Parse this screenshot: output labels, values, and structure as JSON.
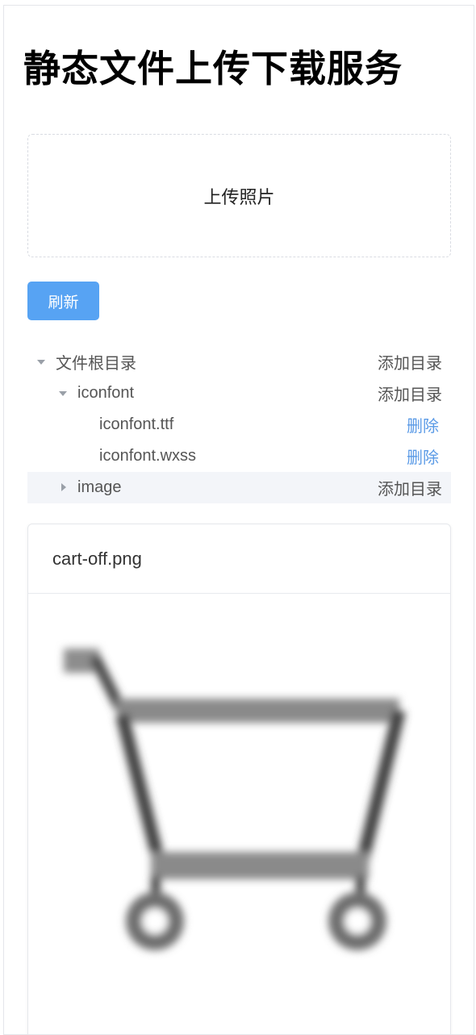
{
  "page": {
    "title": "静态文件上传下载服务"
  },
  "upload": {
    "label": "上传照片"
  },
  "toolbar": {
    "refresh_label": "刷新"
  },
  "tree": {
    "root": {
      "label": "文件根目录",
      "action": "添加目录",
      "expanded": true
    },
    "folders": [
      {
        "label": "iconfont",
        "action": "添加目录",
        "expanded": true,
        "files": [
          {
            "label": "iconfont.ttf",
            "action": "删除"
          },
          {
            "label": "iconfont.wxss",
            "action": "删除"
          }
        ]
      },
      {
        "label": "image",
        "action": "添加目录",
        "expanded": false
      }
    ]
  },
  "preview": {
    "filename": "cart-off.png",
    "image_icon": "shopping-cart-icon"
  },
  "colors": {
    "primary": "#57a3f3",
    "link": "#5a9ae6",
    "hover_row": "#f3f5f9",
    "icon_gray": "#8a8a8a"
  }
}
